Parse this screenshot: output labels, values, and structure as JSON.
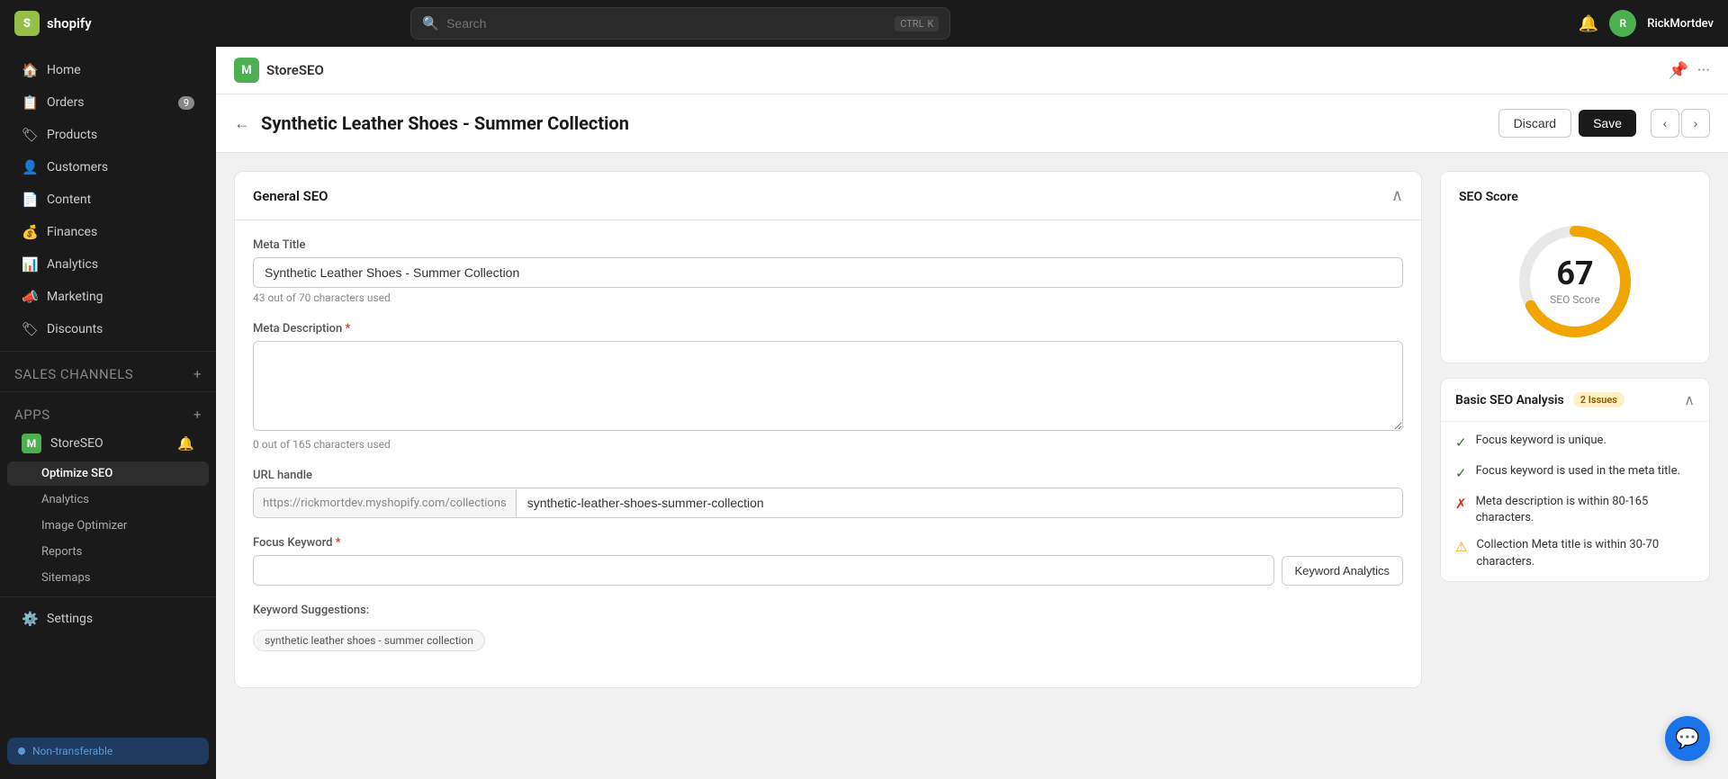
{
  "topbar": {
    "logo_text": "shopify",
    "search_placeholder": "Search",
    "shortcut": [
      "CTRL",
      "K"
    ],
    "username": "RickMortdev"
  },
  "sidebar": {
    "items": [
      {
        "id": "home",
        "label": "Home",
        "icon": "🏠"
      },
      {
        "id": "orders",
        "label": "Orders",
        "icon": "📋",
        "badge": "9"
      },
      {
        "id": "products",
        "label": "Products",
        "icon": "🏷"
      },
      {
        "id": "customers",
        "label": "Customers",
        "icon": "👤"
      },
      {
        "id": "content",
        "label": "Content",
        "icon": "📄"
      },
      {
        "id": "finances",
        "label": "Finances",
        "icon": "💰"
      },
      {
        "id": "analytics",
        "label": "Analytics",
        "icon": "📊"
      },
      {
        "id": "marketing",
        "label": "Marketing",
        "icon": "📣"
      },
      {
        "id": "discounts",
        "label": "Discounts",
        "icon": "🏷"
      }
    ],
    "sales_channels_label": "Sales channels",
    "apps_label": "Apps",
    "app_items": [
      {
        "id": "storeseo",
        "label": "StoreSEO",
        "icon": "M"
      }
    ],
    "sub_items": [
      {
        "id": "optimize-seo",
        "label": "Optimize SEO",
        "active": true
      },
      {
        "id": "analytics",
        "label": "Analytics"
      },
      {
        "id": "image-optimizer",
        "label": "Image Optimizer"
      },
      {
        "id": "reports",
        "label": "Reports"
      },
      {
        "id": "sitemaps",
        "label": "Sitemaps"
      }
    ],
    "settings_label": "Settings",
    "non_transferable_label": "Non-transferable"
  },
  "app_header": {
    "app_icon": "M",
    "app_name": "StoreSEO"
  },
  "page_header": {
    "title": "Synthetic Leather Shoes - Summer Collection",
    "discard_label": "Discard",
    "save_label": "Save"
  },
  "general_seo": {
    "panel_title": "General SEO",
    "meta_title_label": "Meta Title",
    "meta_title_value": "Synthetic Leather Shoes - Summer Collection",
    "meta_title_char_count": "43 out of 70 characters used",
    "meta_desc_label": "Meta Description",
    "meta_desc_required": "*",
    "meta_desc_value": "",
    "meta_desc_char_count": "0 out of 165 characters used",
    "url_handle_label": "URL handle",
    "url_prefix": "https://rickmortdev.myshopify.com/collections",
    "url_handle_value": "synthetic-leather-shoes-summer-collection",
    "focus_keyword_label": "Focus Keyword",
    "focus_keyword_required": "*",
    "focus_keyword_value": "",
    "keyword_analytics_btn": "Keyword Analytics",
    "keyword_suggestions_label": "Keyword Suggestions:",
    "keyword_suggestion_tag": "synthetic leather shoes - summer collection"
  },
  "seo_score": {
    "title": "SEO Score",
    "score": "67",
    "score_label": "SEO Score",
    "score_value": 67,
    "max_score": 100
  },
  "basic_seo_analysis": {
    "title": "Basic SEO Analysis",
    "issues_badge": "2 Issues",
    "items": [
      {
        "type": "check",
        "text": "Focus keyword is unique."
      },
      {
        "type": "check",
        "text": "Focus keyword is used in the meta title."
      },
      {
        "type": "cross",
        "text": "Meta description is within 80-165 characters."
      },
      {
        "type": "warn",
        "text": "Collection Meta title is within 30-70 characters."
      }
    ]
  }
}
